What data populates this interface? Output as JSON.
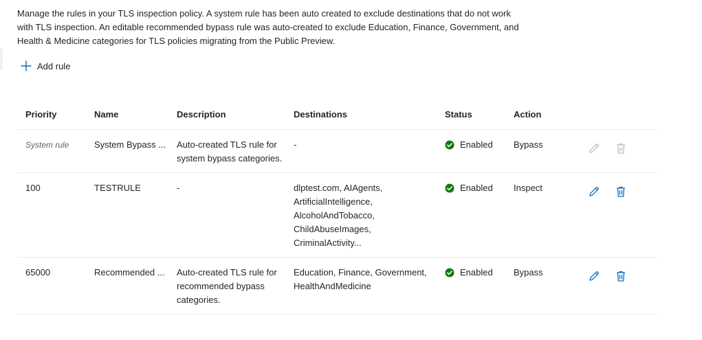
{
  "intro": {
    "text": "Manage the rules in your TLS inspection policy. A system rule has been auto created to exclude destinations that do not work with TLS inspection. An editable recommended bypass rule was auto-created to exclude Education, Finance, Government, and Health & Medicine categories for TLS policies migrating from the Public Preview."
  },
  "toolbar": {
    "add_rule_label": "Add rule"
  },
  "table": {
    "headers": {
      "priority": "Priority",
      "name": "Name",
      "description": "Description",
      "destinations": "Destinations",
      "status": "Status",
      "action": "Action"
    },
    "rows": [
      {
        "priority": "System rule",
        "name": "System Bypass ...",
        "description": "Auto-created TLS rule for system bypass categories.",
        "destinations": "-",
        "status": "Enabled",
        "action": "Bypass",
        "editable": false
      },
      {
        "priority": "100",
        "name": "TESTRULE",
        "description": "-",
        "destinations": "dlptest.com, AIAgents, ArtificialIntelligence, AlcoholAndTobacco, ChildAbuseImages, CriminalActivity...",
        "status": "Enabled",
        "action": "Inspect",
        "editable": true
      },
      {
        "priority": "65000",
        "name": "Recommended ...",
        "description": "Auto-created TLS rule for recommended bypass categories.",
        "destinations": "Education, Finance, Government, HealthAndMedicine",
        "status": "Enabled",
        "action": "Bypass",
        "editable": true
      }
    ]
  },
  "icons": {
    "add": "plus-icon",
    "status": "check-circle-icon",
    "edit": "pencil-icon",
    "delete": "trash-icon"
  },
  "colors": {
    "accent": "#0f6cbd",
    "status_enabled": "#107c10",
    "disabled_icon": "#bdbdbd",
    "text": "#242424",
    "divider": "#ebebeb"
  }
}
